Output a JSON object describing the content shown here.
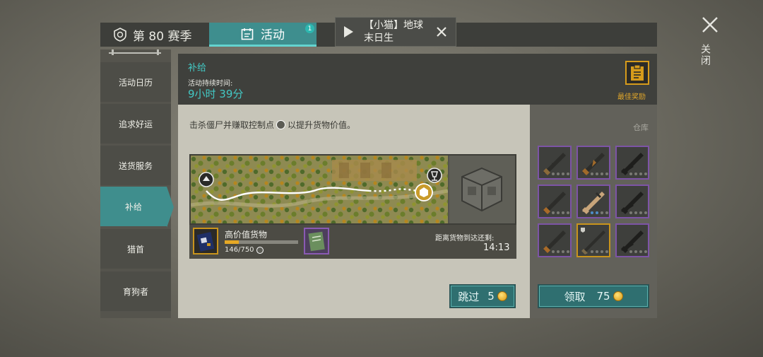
{
  "tabs": {
    "season_label": "第 80 赛季",
    "activity_label": "活动",
    "activity_badge": "1"
  },
  "notification": {
    "text": "【小猫】地球末日生"
  },
  "close_label": "关闭",
  "sidebar": {
    "items": [
      {
        "label": "活动日历"
      },
      {
        "label": "追求好运"
      },
      {
        "label": "送货服务"
      },
      {
        "label": "补给"
      },
      {
        "label": "猎首"
      },
      {
        "label": "育狗者"
      }
    ],
    "active_index": 3
  },
  "header": {
    "title": "补给",
    "duration_label": "活动持续时间:",
    "duration_value": "9小时 39分",
    "reward_label": "最佳奖励"
  },
  "main": {
    "description_pre": "击杀僵尸并赚取控制点",
    "description_post": "以提升货物价值。",
    "cargo_name": "高价值货物",
    "cargo_progress": "146/750",
    "cargo_progress_fraction": 0.195,
    "eta_label": "距离货物到达还剩:",
    "eta_value": "14:13",
    "skip_label": "跳过",
    "skip_cost": "5"
  },
  "warehouse": {
    "label": "仓库",
    "claim_label": "领取",
    "claim_cost": "75"
  },
  "colors": {
    "accent_teal": "#3f8e8d",
    "title_teal": "#43c8c4",
    "gold": "#e5a825",
    "epic_purple": "#7d54a6"
  }
}
